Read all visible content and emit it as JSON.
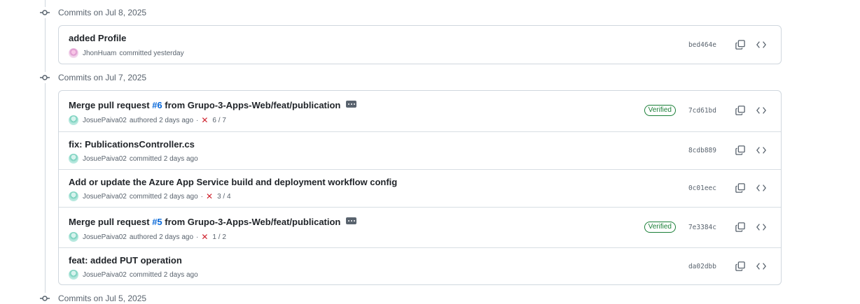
{
  "groups": [
    {
      "title": "Commits on Jul 8, 2025",
      "commits": [
        {
          "message": "added Profile",
          "author": "JhonHuam",
          "action": "committed yesterday",
          "status": "",
          "sha": "bed464e",
          "verified": ""
        }
      ]
    },
    {
      "title": "Commits on Jul 7, 2025",
      "commits": [
        {
          "message_pre": "Merge pull request ",
          "pr": "#6",
          "message_post": " from Grupo-3-Apps-Web/feat/publication",
          "author": "JosuePaiva02",
          "action": "authored 2 days ago",
          "status": "6 / 7",
          "sha": "7cd61bd",
          "verified": "Verified"
        },
        {
          "message": "fix: PublicationsController.cs",
          "author": "JosuePaiva02",
          "action": "committed 2 days ago",
          "status": "",
          "sha": "8cdb889",
          "verified": ""
        },
        {
          "message": "Add or update the Azure App Service build and deployment workflow config",
          "author": "JosuePaiva02",
          "action": "committed 2 days ago",
          "status": "3 / 4",
          "sha": "0c01eec",
          "verified": ""
        },
        {
          "message_pre": "Merge pull request ",
          "pr": "#5",
          "message_post": " from Grupo-3-Apps-Web/feat/publication",
          "author": "JosuePaiva02",
          "action": "authored 2 days ago",
          "status": "1 / 2",
          "sha": "7e3384c",
          "verified": "Verified"
        },
        {
          "message": "feat: added PUT operation",
          "author": "JosuePaiva02",
          "action": "committed 2 days ago",
          "status": "",
          "sha": "da02dbb",
          "verified": ""
        }
      ]
    },
    {
      "title": "Commits on Jul 5, 2025",
      "commits": []
    }
  ],
  "colors": {
    "link": "#0969da",
    "verified": "#1a7f37",
    "fail": "#cf222e",
    "border": "#d0d7de",
    "muted": "#59636e"
  },
  "icons": {
    "commit": "git-commit-icon",
    "copy": "copy-icon",
    "browse": "code-icon",
    "fail": "x-icon",
    "more": "ellipsis-icon"
  }
}
